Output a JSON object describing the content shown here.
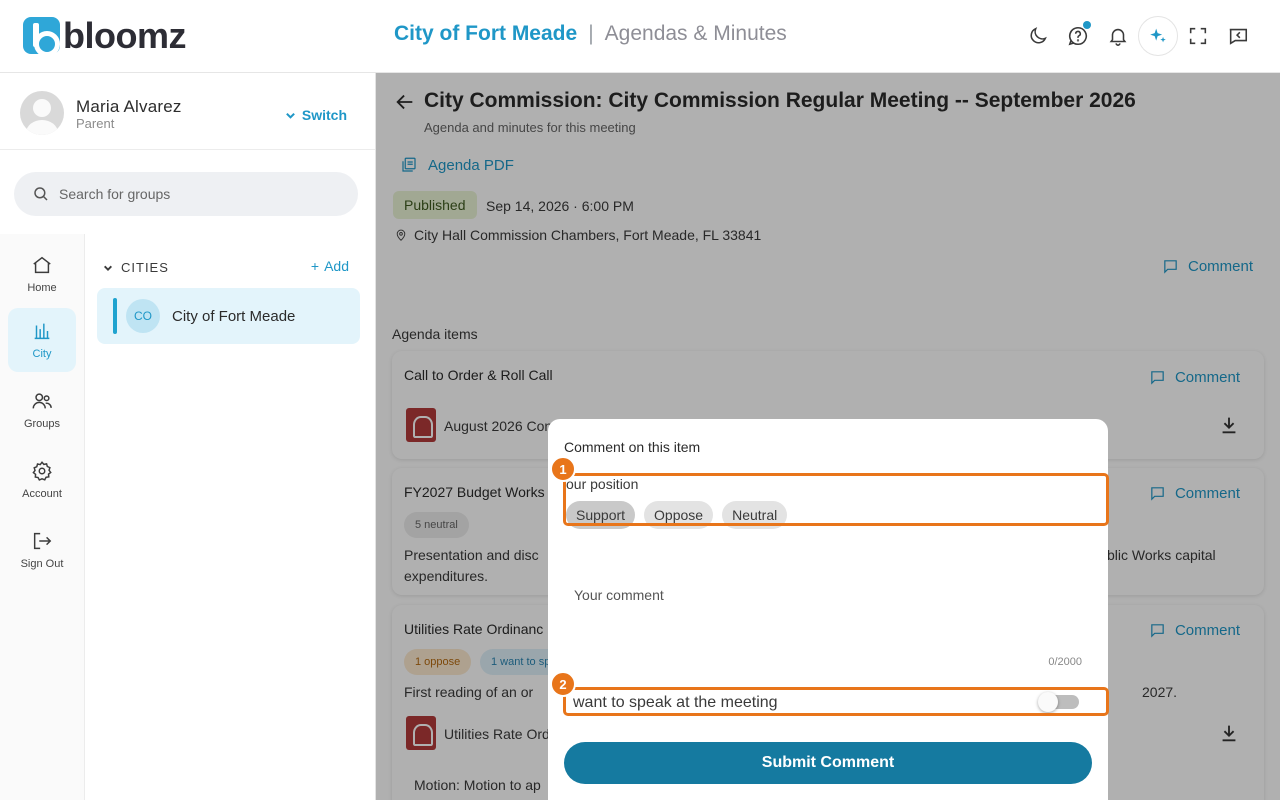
{
  "topbar": {
    "logo_text": "bloomz",
    "city": "City of Fort Meade",
    "separator": "|",
    "section": "Agendas & Minutes",
    "icons": [
      "moon-icon",
      "help-icon",
      "bell-icon",
      "sparkle-icon",
      "fullscreen-icon",
      "chat-icon"
    ]
  },
  "profile": {
    "name": "Maria Alvarez",
    "role": "Parent",
    "switch_label": "Switch"
  },
  "search": {
    "placeholder": "Search for groups"
  },
  "rail": {
    "home": "Home",
    "city": "City",
    "groups": "Groups",
    "account": "Account",
    "signout": "Sign Out"
  },
  "groups": {
    "heading": "CITIES",
    "add_label": "Add",
    "items": [
      {
        "initials": "CO",
        "label": "City of Fort Meade"
      }
    ]
  },
  "meeting": {
    "title": "City Commission: City Commission Regular Meeting -- September 2026",
    "subtitle": "Agenda and minutes for this meeting",
    "pdf_label": "Agenda PDF",
    "status": "Published",
    "date": "Sep 14, 2026 · 6:00 PM",
    "location": "City Hall Commission Chambers, Fort Meade, FL 33841",
    "comment_label": "Comment",
    "agenda_heading": "Agenda items"
  },
  "agenda": [
    {
      "title": "Call to Order & Roll Call",
      "comment_label": "Comment",
      "file": "August 2026 Con"
    },
    {
      "title": "FY2027 Budget Works",
      "comment_label": "Comment",
      "chip": "5 neutral",
      "desc_line1": "Presentation and disc",
      "desc_line1_right": "blic Works capital",
      "desc_line2": "expenditures."
    },
    {
      "title": "Utilities Rate Ordinanc",
      "comment_label": "Comment",
      "chip_oppose": "1 oppose",
      "chip_speak": "1 want to sp",
      "desc_line1": "First reading of an or",
      "desc_line1_right": "2027.",
      "file": "Utilities Rate Ord",
      "motion": "Motion: Motion to ap"
    }
  ],
  "dialog": {
    "title": "Comment on this item",
    "position_label": "our position",
    "positions": [
      "Support",
      "Oppose",
      "Neutral"
    ],
    "selected_position": "Support",
    "comment_placeholder": "Your comment",
    "counter": "0/2000",
    "speak_label": "want to speak at the meeting",
    "speak_toggle_on": false,
    "submit_label": "Submit Comment"
  },
  "annotations": {
    "step1": "1",
    "step2": "2"
  },
  "colors": {
    "accent": "#1f97c7",
    "annotation": "#e8751a",
    "submit": "#157aa0"
  }
}
